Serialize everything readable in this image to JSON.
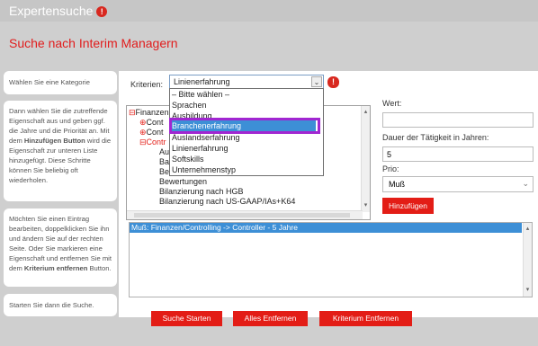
{
  "header": {
    "title": "Expertensuche"
  },
  "subheading": "Suche nach Interim Managern",
  "side": {
    "step1": "Wählen Sie eine Kategorie",
    "step2": {
      "text_a": "Dann wählen Sie die zutreffende Eigenschaft aus und geben ggf. die Jahre und die Priorität an. Mit dem ",
      "bold": "Hinzufügen Button",
      "text_b": " wird die Eigenschaft zur unteren Liste hinzugefügt. Diese Schritte können Sie beliebig oft wiederholen."
    },
    "step3": {
      "text_a": "Möchten Sie einen Eintrag bearbeiten, doppelklicken Sie ihn und ändern Sie auf der rechten Seite. Oder Sie markieren eine Eigenschaft und entfernen Sie mit dem ",
      "bold": "Kriterium entfernen",
      "text_b": " Button."
    },
    "step4": "Starten Sie dann die Suche."
  },
  "kriterien": {
    "label": "Kriterien:",
    "selected": "Linienerfahrung",
    "options": [
      "– Bitte wählen –",
      "Sprachen",
      "Ausbildung",
      "Branchenerfahrung",
      "Auslandserfahrung",
      "Linienerfahrung",
      "Softskills",
      "Unternehmenstyp"
    ],
    "highlighted": "Branchenerfahrung"
  },
  "tree": {
    "items": [
      "Finanzen",
      "Contr",
      "Ausl",
      "Bas",
      "Ber",
      "Bewertungen",
      "Bilanzierung nach HGB",
      "Bilanzierung nach US-GAAP/IAs+K64"
    ],
    "fragments": [
      "Cont",
      "Cont"
    ]
  },
  "fields": {
    "wert_label": "Wert:",
    "wert_value": "",
    "dauer_label": "Dauer der Tätigkeit in Jahren:",
    "dauer_value": "5",
    "prio_label": "Prio:",
    "prio_value": "Muß"
  },
  "buttons": {
    "add": "Hinzufügen",
    "search": "Suche Starten",
    "remove_all": "Alles Entfernen",
    "remove_criterion": "Kriterium Entfernen"
  },
  "selected_list": [
    "Muß: Finanzen/Controlling -> Controller - 5 Jahre"
  ],
  "colors": {
    "accent": "#e31d16",
    "highlight": "#3d8fd6",
    "focus": "#a126d1"
  }
}
